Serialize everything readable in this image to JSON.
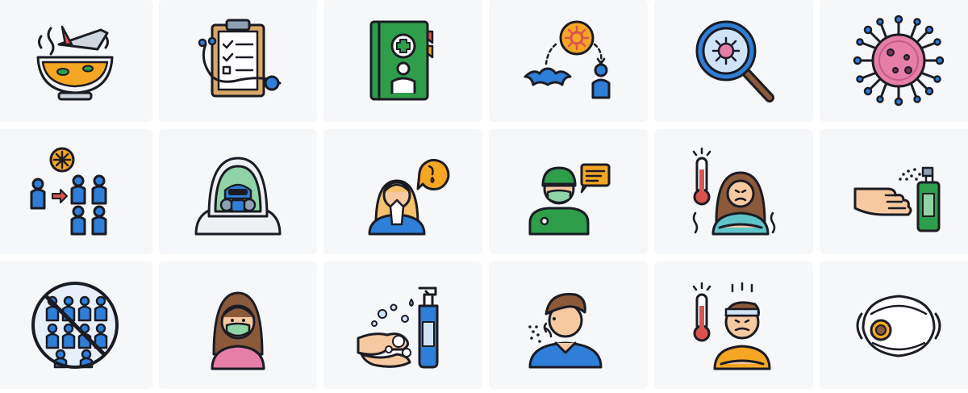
{
  "icons": [
    {
      "name": "soup-bowl-icon"
    },
    {
      "name": "medical-checklist-icon"
    },
    {
      "name": "medical-book-icon"
    },
    {
      "name": "bat-virus-transmission-icon"
    },
    {
      "name": "virus-magnifier-icon"
    },
    {
      "name": "coronavirus-icon"
    },
    {
      "name": "virus-spread-people-icon"
    },
    {
      "name": "hazmat-suit-icon"
    },
    {
      "name": "sneezing-woman-icon"
    },
    {
      "name": "doctor-mask-icon"
    },
    {
      "name": "fever-woman-icon"
    },
    {
      "name": "hand-sanitizer-spray-icon"
    },
    {
      "name": "no-crowd-icon"
    },
    {
      "name": "woman-mask-icon"
    },
    {
      "name": "hand-washing-soap-icon"
    },
    {
      "name": "coughing-man-icon"
    },
    {
      "name": "fever-man-icon"
    },
    {
      "name": "n95-mask-icon"
    }
  ],
  "colors": {
    "tile_background": "#f6f7f9",
    "outline": "#1b1b24",
    "blue": "#2f7fd8",
    "green": "#2f9e4b",
    "orange": "#f5a623",
    "pink": "#e57fa8",
    "skin": "#f7c9a0",
    "hair_brown": "#8a5a3b",
    "mask_green": "#8fd3a6",
    "red": "#d9534f"
  }
}
